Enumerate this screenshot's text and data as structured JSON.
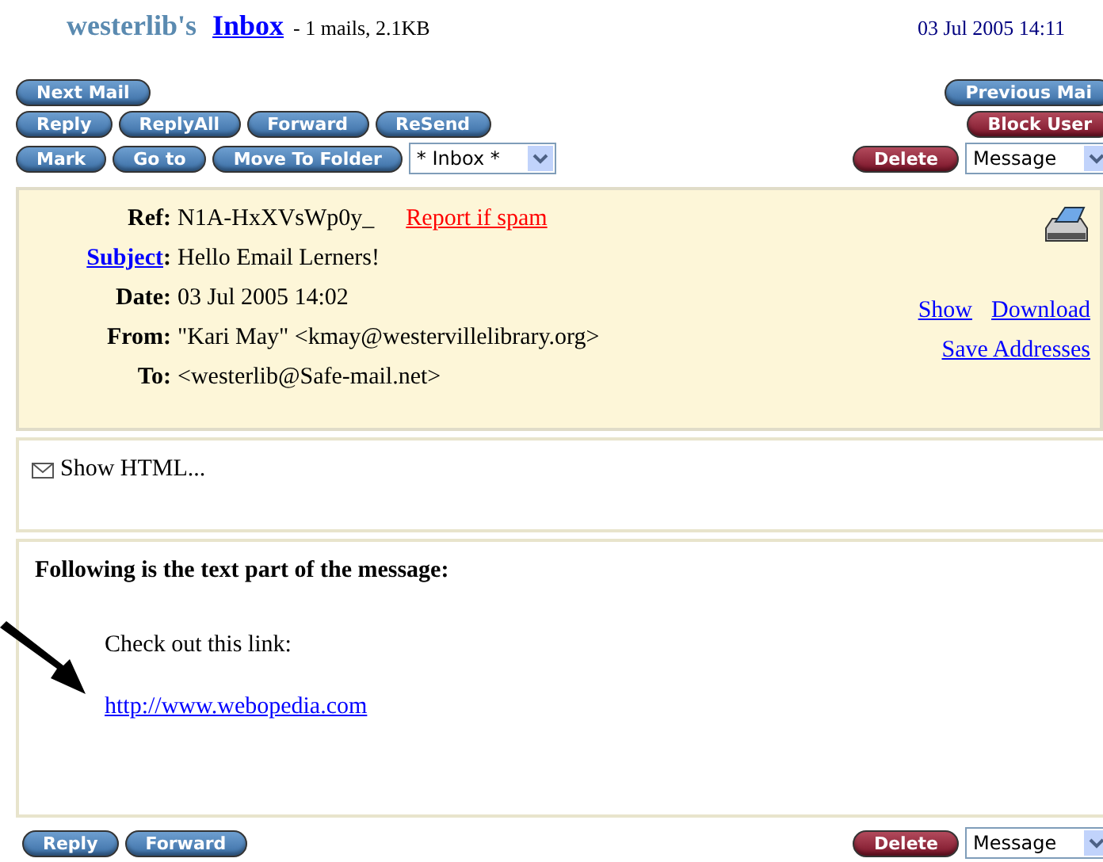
{
  "header": {
    "user": "westerlib",
    "user_suffix": "'s",
    "folder": "Inbox",
    "summary": "- 1 mails, 2.1KB",
    "datetime": "03 Jul 2005 14:11"
  },
  "toolbar": {
    "rows": [
      {
        "left": [
          {
            "label": "Next Mail",
            "kind": "blue"
          }
        ],
        "right": [
          {
            "label": "Previous Mai",
            "kind": "blue"
          }
        ]
      },
      {
        "left": [
          {
            "label": "Reply",
            "kind": "blue"
          },
          {
            "label": "ReplyAll",
            "kind": "blue"
          },
          {
            "label": "Forward",
            "kind": "blue"
          },
          {
            "label": "ReSend",
            "kind": "blue"
          }
        ],
        "right": [
          {
            "label": "Block User",
            "kind": "red"
          }
        ]
      },
      {
        "left": [
          {
            "label": "Mark",
            "kind": "blue"
          },
          {
            "label": "Go to",
            "kind": "blue"
          },
          {
            "label": "Move To Folder",
            "kind": "blue"
          },
          {
            "label": "* Inbox *",
            "kind": "dropdown"
          }
        ],
        "right": [
          {
            "label": "Delete",
            "kind": "red"
          },
          {
            "label": "Message",
            "kind": "dropdown"
          }
        ]
      }
    ]
  },
  "message_header": {
    "fields": [
      {
        "label": "Ref",
        "separator": ":",
        "value": "N1A-HxXVsWp0y_",
        "label_link": false,
        "action": "Report if spam"
      },
      {
        "label": "Subject",
        "separator": ":",
        "value": "Hello Email Lerners!",
        "label_link": true
      },
      {
        "label": "Date",
        "separator": ":",
        "value": "03 Jul 2005 14:02",
        "label_link": false
      },
      {
        "label": "From",
        "separator": ":",
        "value": "\"Kari May\" <kmay@westervillelibrary.org>",
        "label_link": false
      },
      {
        "label": "To",
        "separator": ":",
        "value": "<westerlib@Safe-mail.net>",
        "label_link": false
      }
    ],
    "links": [
      "Show",
      "Download",
      "Save Addresses"
    ]
  },
  "html_panel": {
    "label": "Show HTML..."
  },
  "body": {
    "heading": "Following is the text part of the message:",
    "text": "Check out this link:",
    "link": "http://www.webopedia.com"
  },
  "bottom_bar": {
    "left": [
      {
        "label": "Reply",
        "kind": "blue"
      },
      {
        "label": "Forward",
        "kind": "blue"
      }
    ],
    "right": [
      {
        "label": "Delete",
        "kind": "red"
      },
      {
        "label": "Message",
        "kind": "dropdown"
      }
    ]
  }
}
